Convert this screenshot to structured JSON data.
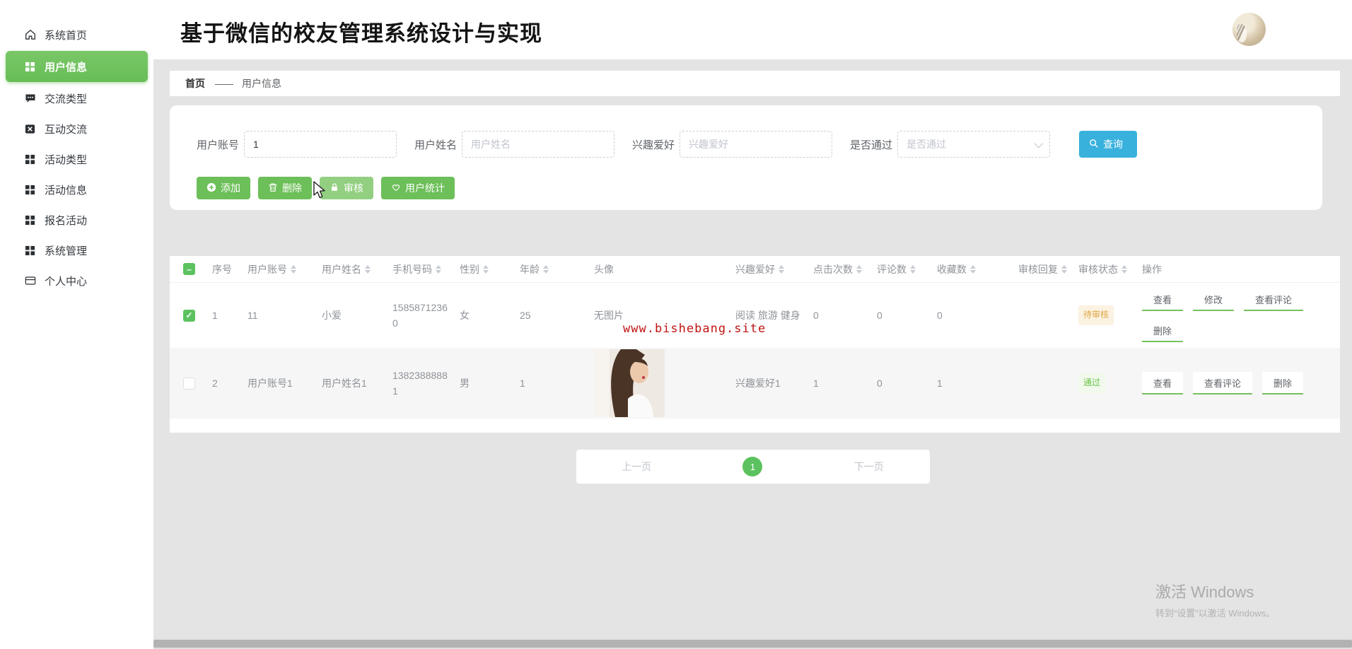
{
  "header": {
    "title": "基于微信的校友管理系统设计与实现"
  },
  "sidebar": {
    "items": [
      {
        "label": "系统首页",
        "icon": "home-icon",
        "active": false
      },
      {
        "label": "用户信息",
        "icon": "grid-icon",
        "active": true
      },
      {
        "label": "交流类型",
        "icon": "chat-icon",
        "active": false
      },
      {
        "label": "互动交流",
        "icon": "calendar-x-icon",
        "active": false
      },
      {
        "label": "活动类型",
        "icon": "grid-icon",
        "active": false
      },
      {
        "label": "活动信息",
        "icon": "grid-icon",
        "active": false
      },
      {
        "label": "报名活动",
        "icon": "grid-icon",
        "active": false
      },
      {
        "label": "系统管理",
        "icon": "grid-icon",
        "active": false
      },
      {
        "label": "个人中心",
        "icon": "card-icon",
        "active": false
      }
    ]
  },
  "breadcrumb": {
    "home": "首页",
    "separator": "——",
    "current": "用户信息"
  },
  "search": {
    "account_label": "用户账号",
    "account_value": "1",
    "name_label": "用户姓名",
    "name_placeholder": "用户姓名",
    "interest_label": "兴趣爱好",
    "interest_placeholder": "兴趣爱好",
    "pass_label": "是否通过",
    "pass_placeholder": "是否通过",
    "query_label": "查询"
  },
  "toolbar": {
    "add_label": "添加",
    "delete_label": "删除",
    "audit_label": "审核",
    "stats_label": "用户统计"
  },
  "table": {
    "columns": [
      {
        "label": "序号",
        "sortable": false
      },
      {
        "label": "用户账号",
        "sortable": true
      },
      {
        "label": "用户姓名",
        "sortable": true
      },
      {
        "label": "手机号码",
        "sortable": true
      },
      {
        "label": "性别",
        "sortable": true
      },
      {
        "label": "年龄",
        "sortable": true
      },
      {
        "label": "头像",
        "sortable": false
      },
      {
        "label": "兴趣爱好",
        "sortable": true
      },
      {
        "label": "点击次数",
        "sortable": true
      },
      {
        "label": "评论数",
        "sortable": true
      },
      {
        "label": "收藏数",
        "sortable": true
      },
      {
        "label": "审核回复",
        "sortable": true
      },
      {
        "label": "审核状态",
        "sortable": true
      },
      {
        "label": "操作",
        "sortable": false
      }
    ],
    "rows": [
      {
        "checked": true,
        "index": "1",
        "account": "11",
        "name": "小爱",
        "phone": "15858712360",
        "gender": "女",
        "age": "25",
        "avatar_text": "无图片",
        "interests": "阅读 旅游 健身",
        "clicks": "0",
        "comments": "0",
        "favorites": "0",
        "reply": "",
        "status": "待审核",
        "status_type": "pending",
        "actions": [
          "查看",
          "修改",
          "查看评论",
          "删除"
        ]
      },
      {
        "checked": false,
        "index": "2",
        "account": "用户账号1",
        "name": "用户姓名1",
        "phone": "13823888881",
        "gender": "男",
        "age": "1",
        "avatar_text": "",
        "interests": "兴趣爱好1",
        "clicks": "1",
        "comments": "0",
        "favorites": "1",
        "reply": "",
        "status": "通过",
        "status_type": "passed",
        "actions": [
          "查看",
          "查看评论",
          "删除"
        ]
      }
    ]
  },
  "pagination": {
    "prev_label": "上一页",
    "page": "1",
    "next_label": "下一页"
  },
  "overlays": {
    "site_watermark": "www.bishebang.site",
    "activate_title": "激活 Windows",
    "activate_subtitle": "转到“设置”以激活 Windows。"
  },
  "colors": {
    "accent_green": "#6cbf59",
    "query_blue": "#38b1dd",
    "pending_orange": "#dfa744",
    "passed_green": "#6cc24a",
    "watermark_red": "#c01414"
  }
}
